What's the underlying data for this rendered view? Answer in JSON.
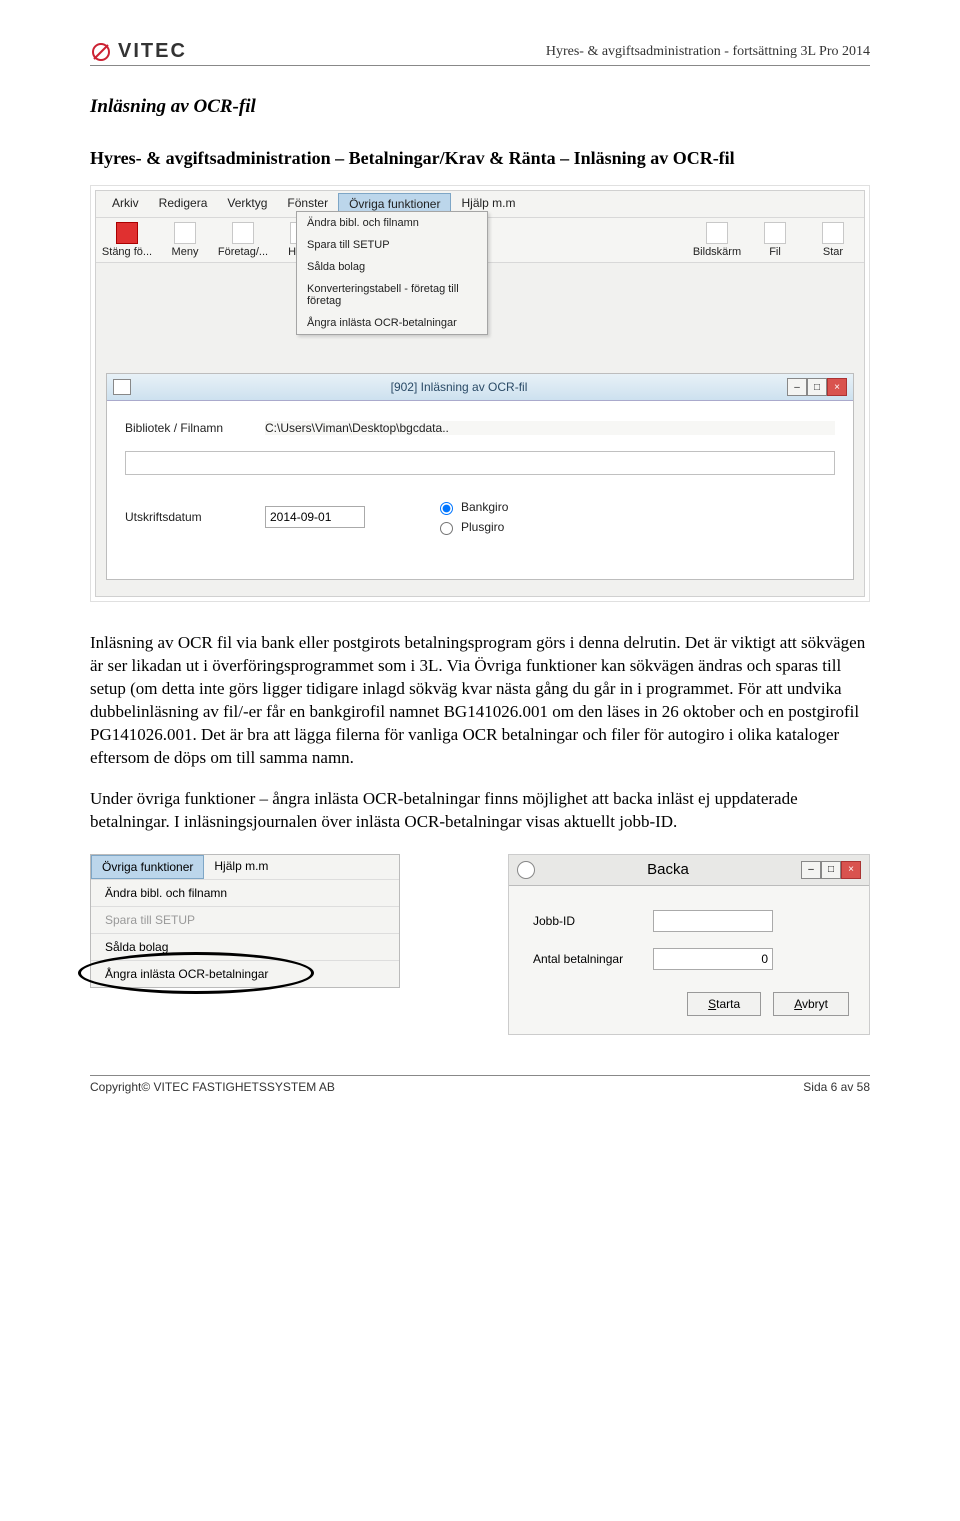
{
  "header": {
    "brand": "VITEC",
    "doc_title": "Hyres- & avgiftsadministration - fortsättning 3L Pro 2014"
  },
  "section": {
    "title": "Inläsning av OCR-fil",
    "subtitle": "Hyres- & avgiftsadministration – Betalningar/Krav & Ränta – Inläsning av OCR-fil"
  },
  "app1": {
    "menus": [
      "Arkiv",
      "Redigera",
      "Verktyg",
      "Fönster",
      "Övriga funktioner",
      "Hjälp m.m"
    ],
    "active_menu": "Övriga funktioner",
    "dropdown": [
      "Ändra bibl. och filnamn",
      "Spara till SETUP",
      "Sålda bolag",
      "Konverteringstabell - företag till företag",
      "Ångra inlästa OCR-betalningar"
    ],
    "toolbar": [
      {
        "label": "Stäng fö..."
      },
      {
        "label": "Meny"
      },
      {
        "label": "Företag/..."
      },
      {
        "label": "Huvu"
      },
      {
        "label": "Bildskärm"
      },
      {
        "label": "Fil"
      },
      {
        "label": "Star"
      }
    ],
    "win_title": "[902]  Inläsning av OCR-fil",
    "path_label": "Bibliotek / Filnamn",
    "path_value": "C:\\Users\\Viman\\Desktop\\bgcdata..",
    "date_label": "Utskriftsdatum",
    "date_value": "2014-09-01",
    "radio1": "Bankgiro",
    "radio2": "Plusgiro"
  },
  "paragraphs": {
    "p1": "Inläsning av OCR fil via bank eller postgirots betalningsprogram görs i denna delrutin. Det är viktigt att sökvägen är ser likadan ut i överföringsprogrammet som i 3L. Via Övriga funktioner kan sökvägen ändras och sparas till setup (om detta inte görs ligger tidigare inlagd sökväg kvar nästa gång du går in i programmet. För att undvika dubbelinläsning av fil/-er får en bankgirofil namnet BG141026.001 om den läses in 26 oktober och en postgirofil PG141026.001. Det är bra att lägga filerna för vanliga OCR betalningar och filer för autogiro i olika kataloger eftersom de döps om till samma namn.",
    "p2": "Under övriga funktioner – ångra inlästa OCR-betalningar finns möjlighet att backa inläst ej uppdaterade betalningar. I inläsningsjournalen över inlästa OCR-betalningar visas aktuellt jobb-ID."
  },
  "menu2": {
    "hdr": [
      "Övriga funktioner",
      "Hjälp m.m"
    ],
    "items": [
      {
        "t": "Ändra bibl. och filnamn"
      },
      {
        "t": "Spara till SETUP",
        "dis": true
      },
      {
        "t": "Sålda bolag"
      },
      {
        "t": "Ångra inlästa OCR-betalningar"
      }
    ]
  },
  "backa": {
    "title": "Backa",
    "jobb_label": "Jobb-ID",
    "jobb_value": "",
    "antal_label": "Antal betalningar",
    "antal_value": "0",
    "btn_start": "Starta",
    "btn_cancel": "Avbryt"
  },
  "footer": {
    "copyright": "Copyright© VITEC FASTIGHETSSYSTEM AB",
    "page": "Sida 6 av 58"
  }
}
